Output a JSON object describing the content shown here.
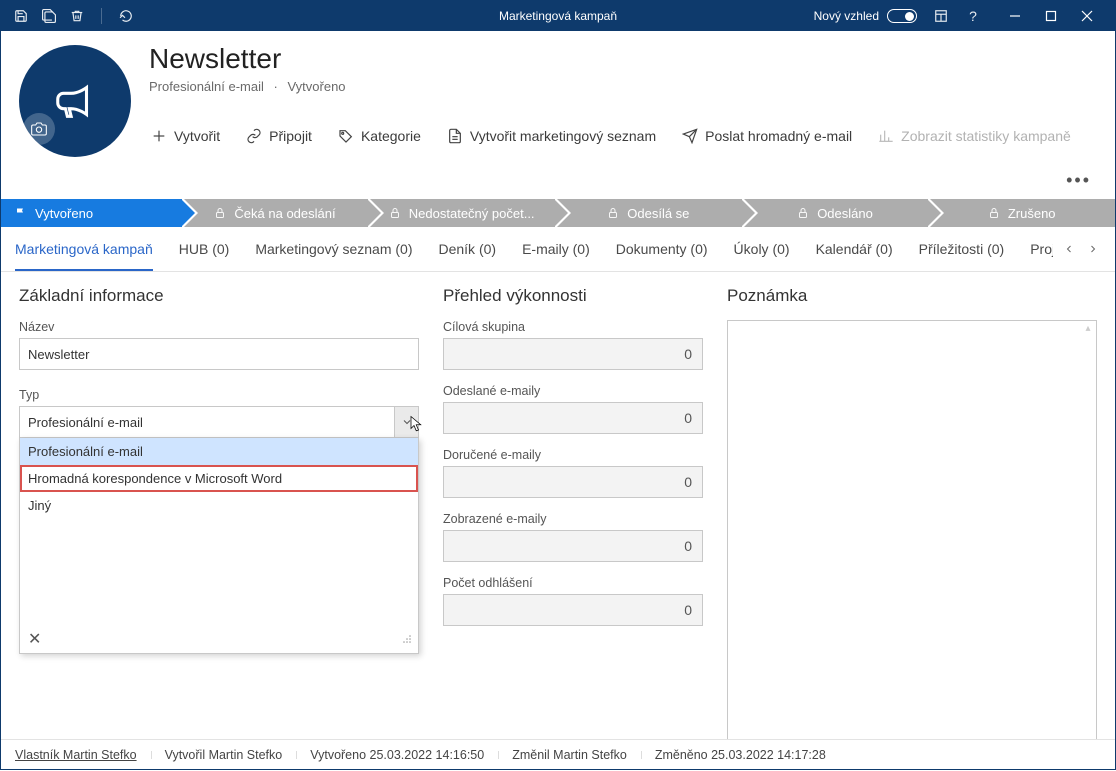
{
  "titlebar": {
    "title": "Marketingová kampaň",
    "new_look_label": "Nový vzhled"
  },
  "header": {
    "title": "Newsletter",
    "subtitle_type": "Profesionální e-mail",
    "subtitle_state": "Vytvořeno"
  },
  "toolbar": {
    "create": "Vytvořit",
    "link": "Připojit",
    "categories": "Kategorie",
    "create_list": "Vytvořit marketingový seznam",
    "send_mass": "Poslat hromadný e-mail",
    "stats": "Zobrazit statistiky kampaně"
  },
  "stages": [
    {
      "label": "Vytvořeno",
      "active": true,
      "locked": false
    },
    {
      "label": "Čeká na odeslání",
      "active": false,
      "locked": true
    },
    {
      "label": "Nedostatečný počet...",
      "active": false,
      "locked": true
    },
    {
      "label": "Odesílá se",
      "active": false,
      "locked": true
    },
    {
      "label": "Odesláno",
      "active": false,
      "locked": true
    },
    {
      "label": "Zrušeno",
      "active": false,
      "locked": true
    }
  ],
  "tabs": [
    "Marketingová kampaň",
    "HUB (0)",
    "Marketingový seznam (0)",
    "Deník (0)",
    "E-maily (0)",
    "Dokumenty (0)",
    "Úkoly (0)",
    "Kalendář (0)",
    "Příležitosti (0)",
    "Projek"
  ],
  "form": {
    "section_basic": "Základní informace",
    "name_label": "Název",
    "name_value": "Newsletter",
    "type_label": "Typ",
    "type_value": "Profesionální e-mail",
    "type_options": [
      "Profesionální e-mail",
      "Hromadná korespondence v Microsoft Word",
      "Jiný"
    ],
    "section_perf": "Přehled výkonnosti",
    "metrics": [
      {
        "label": "Cílová skupina",
        "value": "0"
      },
      {
        "label": "Odeslané e-maily",
        "value": "0"
      },
      {
        "label": "Doručené e-maily",
        "value": "0"
      },
      {
        "label": "Zobrazené e-maily",
        "value": "0"
      },
      {
        "label": "Počet odhlášení",
        "value": "0"
      }
    ],
    "section_note": "Poznámka"
  },
  "footer": {
    "owner": "Vlastník Martin Stefko",
    "created_by": "Vytvořil Martin Stefko",
    "created_on": "Vytvořeno 25.03.2022 14:16:50",
    "modified_by": "Změnil Martin Stefko",
    "modified_on": "Změněno 25.03.2022 14:17:28"
  }
}
